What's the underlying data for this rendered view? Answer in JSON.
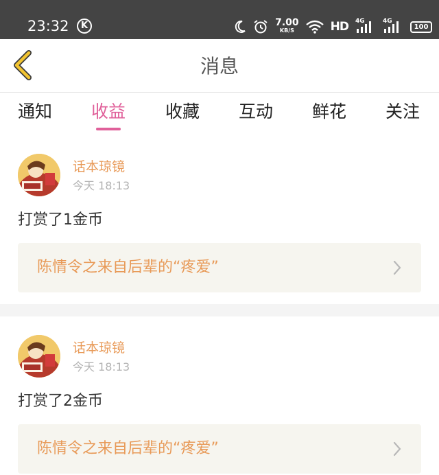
{
  "status_bar": {
    "time": "23:32",
    "k_badge": "K",
    "net_speed_value": "7.00",
    "net_speed_unit": "KB/S",
    "hd": "HD",
    "signal1": "4G",
    "signal2": "4G",
    "battery": "100",
    "icons": [
      "moon-icon",
      "alarm-icon",
      "wifi-icon",
      "signal-icon",
      "battery-icon"
    ]
  },
  "header": {
    "title": "消息",
    "back_icon": "chevron-left-icon",
    "back_color": "#f2c431"
  },
  "tabs": [
    {
      "label": "通知",
      "active": false
    },
    {
      "label": "收益",
      "active": true
    },
    {
      "label": "收藏",
      "active": false
    },
    {
      "label": "互动",
      "active": false
    },
    {
      "label": "鲜花",
      "active": false
    },
    {
      "label": "关注",
      "active": false
    }
  ],
  "accent_color": "#e0609a",
  "messages": [
    {
      "sender": "话本琼镜",
      "time": "今天 18:13",
      "text": "打赏了1金币",
      "card_text": "陈情令之来自后辈的“疼爱”"
    },
    {
      "sender": "话本琼镜",
      "time": "今天 18:13",
      "text": "打赏了2金币",
      "card_text": "陈情令之来自后辈的“疼爱”"
    }
  ]
}
